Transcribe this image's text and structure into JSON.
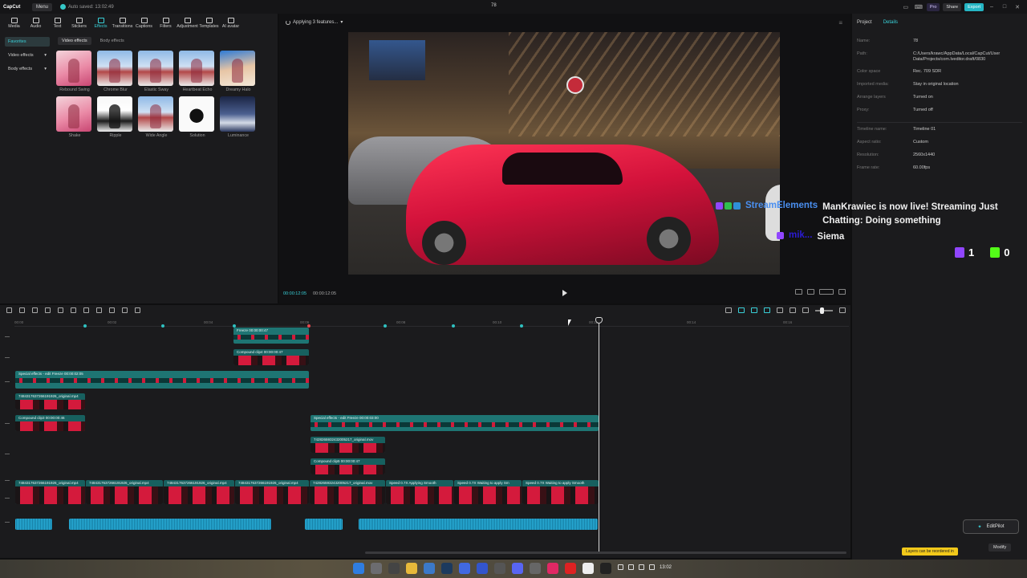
{
  "titlebar": {
    "app_logo": "CapCut",
    "menu": "Menu",
    "autosave": "Auto saved: 13:02:49",
    "project_title": "78",
    "pro": "Pro",
    "share": "Share",
    "export": "Export"
  },
  "toolbar": [
    "Media",
    "Audio",
    "Text",
    "Stickers",
    "Effects",
    "Transitions",
    "Captions",
    "Filters",
    "Adjustment",
    "Templates",
    "AI avatar"
  ],
  "left": {
    "categories": [
      "Favorites",
      "Video effects",
      "Body effects"
    ],
    "subtabs": [
      "Video effects",
      "Body effects"
    ],
    "effects": [
      "Rebound Swing",
      "Chrome Blur",
      "Elastic Sway",
      "Heartbeat Echo",
      "Dreamy Halo",
      "Shake",
      "Ripple",
      "Wide Angle",
      "Solution",
      "Luminance"
    ]
  },
  "player": {
    "applying": "Applying 3 features...",
    "timecode": "00:00:12:05",
    "duration": "00:00:12:05"
  },
  "overlay": {
    "se_name": "StreamElements",
    "se_message": "ManKrawiec is now live! Streaming Just Chatting: Doing something",
    "user_name": "mik...",
    "user_message": "Siema",
    "twitch_count": "1",
    "kick_count": "0"
  },
  "right": {
    "tabs": [
      "Project",
      "Details"
    ],
    "props": [
      {
        "k": "Name:",
        "v": "78"
      },
      {
        "k": "Path:",
        "v": "C:/Users/krawc/AppData/Local/CapCut/User Data/Projects/com.lveditor.draft/0830"
      },
      {
        "k": "Color space",
        "v": "Rec. 709 SDR"
      },
      {
        "k": "Imported media:",
        "v": "Stay in original location"
      },
      {
        "k": "Arrange layers",
        "v": "Turned on"
      },
      {
        "k": "Proxy:",
        "v": "Turned off"
      }
    ],
    "props2": [
      {
        "k": "Timeline name:",
        "v": "Timeline 01"
      },
      {
        "k": "Aspect ratio:",
        "v": "Custom"
      },
      {
        "k": "Resolution:",
        "v": "2560x1440"
      },
      {
        "k": "Frame rate:",
        "v": "60.00fps"
      }
    ],
    "editpilot": "EditPilot",
    "modify": "Modify",
    "tooltip": "Layers can be reordered in"
  },
  "timeline": {
    "ticks": [
      "00:00",
      "00:02",
      "00:04",
      "00:06",
      "00:08",
      "00:10",
      "00:12",
      "00:14",
      "00:16"
    ],
    "clips": {
      "freeze_top": "Freeze  00:00:00:47",
      "compound_top": "Compound clip4  00:00:00:47",
      "fx_left": "Special effects - edit  Freeze  00:00:02:05",
      "vid_small": "7484317637266191926_original.mp4",
      "compound3": "Compound clip3  00:00:00:46",
      "fx_right": "Special effects - edit  Freeze  00:00:03:00",
      "vid_mid": "7428265932432005217_original.mov",
      "compound5": "Compound clip5  00:00:00:47",
      "main1": "7484317637266191926_original.mp4",
      "main2": "7484317637266191926_original.mp4",
      "main3": "7484317637266191926_original.mp4",
      "main4": "7484317637266191926_original.mp4",
      "main5": "7428265932432005217_original.mov",
      "main6": "Speed 0.7X  Applying Smooth",
      "main7": "Speed 0.7X  Waiting to apply Sm",
      "main8": "Speed 0.7X  Waiting to apply Smooth"
    }
  },
  "taskbar": {
    "time": "13:02"
  },
  "colors": {
    "accent": "#39d0d8",
    "clip_teal": "#1e7573",
    "audio_blue": "#1a8fb8",
    "export": "#25b6c5"
  }
}
